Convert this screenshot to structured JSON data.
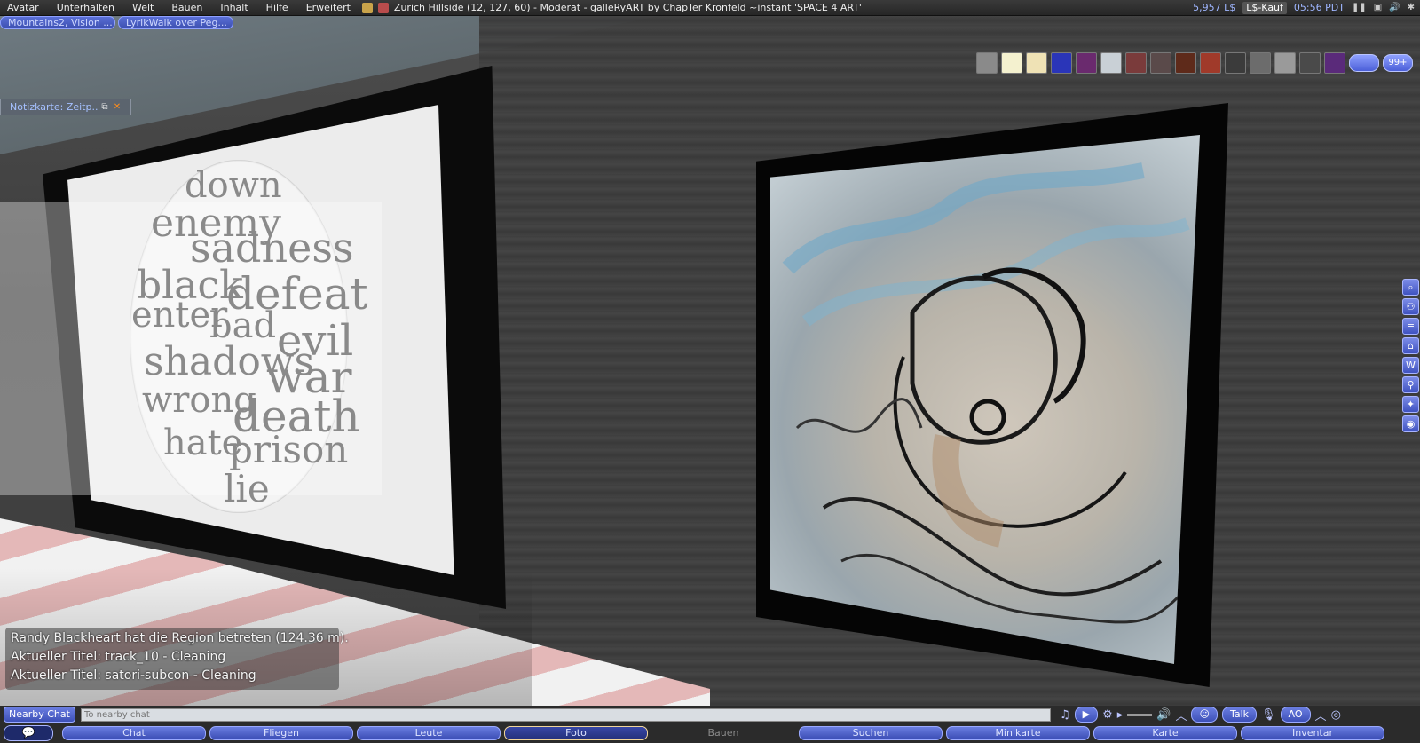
{
  "menubar": {
    "items": [
      "Avatar",
      "Unterhalten",
      "Welt",
      "Bauen",
      "Inhalt",
      "Hilfe",
      "Erweitert"
    ],
    "location": "Zurich Hillside (12, 127, 60) - Moderat - galleRyART by ChapTer Kronfeld ~instant 'SPACE 4 ART'",
    "balance": "5,957 L$",
    "buy_label": "L$-Kauf",
    "time": "05:56 PDT"
  },
  "favorites": [
    "Mountains2, Vision ...",
    "LyrikWalk over Peg..."
  ],
  "notecard": {
    "title": "Notizkarte: Zeitp..."
  },
  "hud": {
    "more_label": "99+"
  },
  "word_cloud": [
    "down",
    "enemy",
    "sadness",
    "black",
    "defeat",
    "enter",
    "bad",
    "evil",
    "shadows",
    "war",
    "wrong",
    "death",
    "hate",
    "prison",
    "lie"
  ],
  "chat_history": [
    "Randy Blackheart hat die Region betreten (124.36 m).",
    "Aktueller Titel: track_10 - Cleaning",
    "Aktueller Titel: satori-subcon - Cleaning"
  ],
  "chatbar": {
    "nearby_label": "Nearby Chat",
    "input_placeholder": "To nearby chat",
    "talk_label": "Talk",
    "ao_label": "AO"
  },
  "bottom_tabs": [
    {
      "label": "Chat",
      "state": "normal"
    },
    {
      "label": "Fliegen",
      "state": "normal"
    },
    {
      "label": "Leute",
      "state": "normal"
    },
    {
      "label": "Foto",
      "state": "active"
    },
    {
      "label": "Bauen",
      "state": "disabled"
    },
    {
      "label": "Suchen",
      "state": "normal"
    },
    {
      "label": "Minikarte",
      "state": "normal"
    },
    {
      "label": "Karte",
      "state": "normal"
    },
    {
      "label": "Inventar",
      "state": "normal"
    }
  ],
  "colors": {
    "accent": "#4b5fd8",
    "active_border": "#f1d59b",
    "close": "#ff8c1a"
  }
}
